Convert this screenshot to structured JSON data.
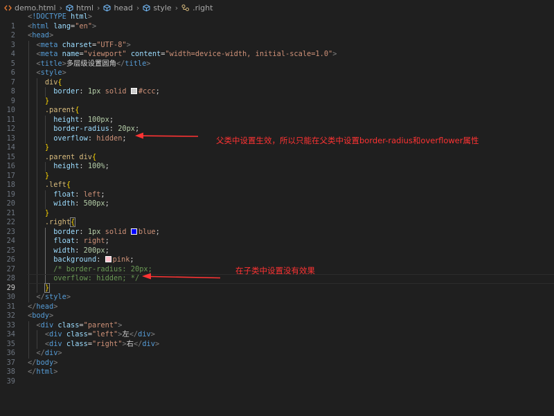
{
  "breadcrumb": {
    "file": "demo.html",
    "items": [
      "html",
      "head",
      "style",
      ".right"
    ]
  },
  "colors": {
    "annotation": "#ff3333",
    "swatch_ccc": "#cccccc",
    "swatch_blue": "#0000ff",
    "swatch_pink": "#ffc0cb"
  },
  "line_numbers": [
    "1",
    "2",
    "3",
    "4",
    "5",
    "6",
    "7",
    "8",
    "9",
    "10",
    "11",
    "12",
    "13",
    "14",
    "15",
    "16",
    "17",
    "18",
    "19",
    "20",
    "21",
    "22",
    "23",
    "24",
    "25",
    "26",
    "27",
    "28",
    "29",
    "30",
    "31",
    "32",
    "33",
    "34",
    "35",
    "36",
    "37",
    "38",
    "39"
  ],
  "code": {
    "l1_doctype": "!DOCTYPE",
    "l1_html": "html",
    "l2_lang_attr": "lang",
    "l2_lang_val": "\"en\"",
    "l4_charset_attr": "charset",
    "l4_charset_val": "\"UTF-8\"",
    "l5_name_attr": "name",
    "l5_name_val": "\"viewport\"",
    "l5_content_attr": "content",
    "l5_content_val": "\"width=device-width, initial-scale=1.0\"",
    "l6_title_text": "多层级设置圆角",
    "l8_selector": "div",
    "l9_prop": "border",
    "l9_val1": "1px",
    "l9_val2": "solid",
    "l9_val3": "#ccc",
    "l11_selector": ".parent",
    "l12_prop": "height",
    "l12_val": "100px",
    "l13_prop": "border-radius",
    "l13_val": "20px",
    "l14_prop": "overflow",
    "l14_val": "hidden",
    "l16_selector": ".parent div",
    "l17_prop": "height",
    "l17_val": "100%",
    "l19_selector": ".left",
    "l20_prop": "float",
    "l20_val": "left",
    "l21_prop": "width",
    "l21_val": "500px",
    "l23_selector": ".right",
    "l24_prop": "border",
    "l24_val1": "1px",
    "l24_val2": "solid",
    "l24_val3": "blue",
    "l25_prop": "float",
    "l25_val": "right",
    "l26_prop": "width",
    "l26_val": "200px",
    "l27_prop": "background",
    "l27_val": "pink",
    "l28_comment": "/* border-radius: 20px;",
    "l29_comment": "overflow: hidden; */",
    "l34_class_attr": "class",
    "l34_class_val": "\"parent\"",
    "l35_class_attr": "class",
    "l35_class_val": "\"left\"",
    "l35_text": "左",
    "l36_class_attr": "class",
    "l36_class_val": "\"right\"",
    "l36_text": "右"
  },
  "annotations": {
    "parent_note": "父类中设置生效，所以只能在父类中设置border-radius和overflower属性",
    "child_note": "在子类中设置没有效果"
  }
}
